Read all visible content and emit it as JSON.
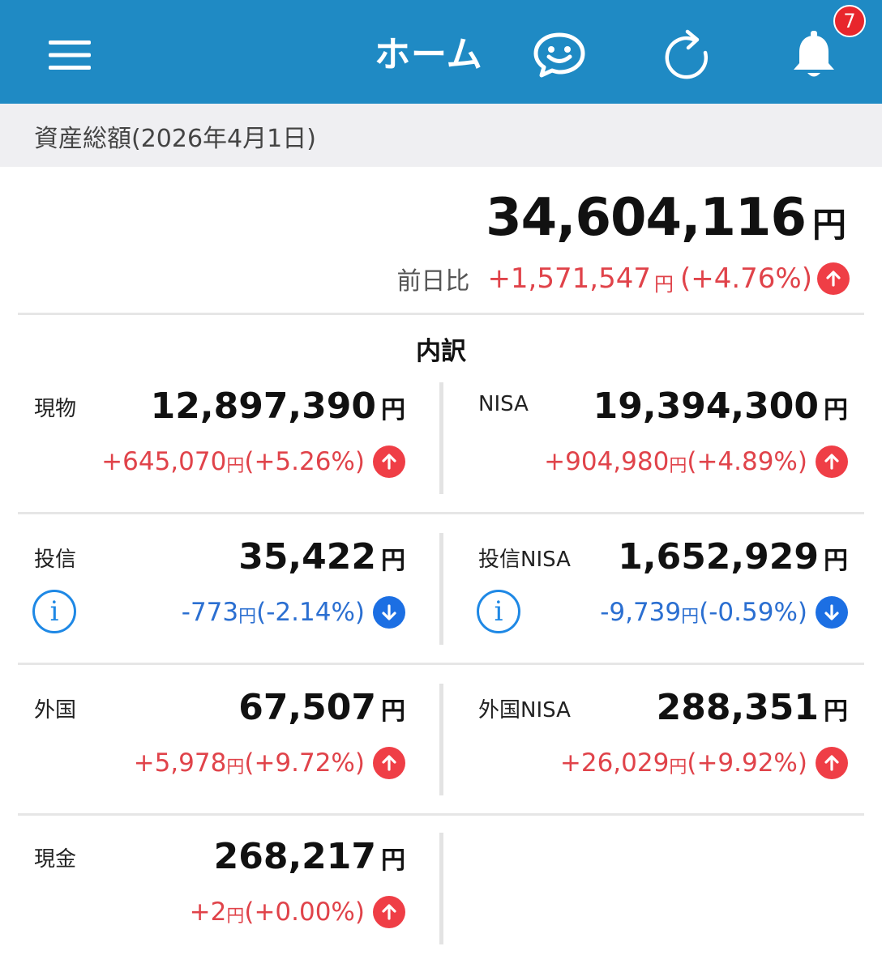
{
  "header": {
    "title": "ホーム",
    "badge_count": "7",
    "color": "#1f8ac4"
  },
  "summary": {
    "date_label": "資産総額(2026年4月1日)",
    "total_value": "34,604,116",
    "currency": "円",
    "change_label": "前日比",
    "change_value": "+1,571,547",
    "change_pct": "(+4.76%)"
  },
  "breakdown": {
    "title": "内訳",
    "items": [
      {
        "label": "現物",
        "value": "12,897,390",
        "yen": "円",
        "change": "+645,070",
        "pct": "(+5.26%)",
        "direction": "up"
      },
      {
        "label": "NISA",
        "value": "19,394,300",
        "yen": "円",
        "change": "+904,980",
        "pct": "(+4.89%)",
        "direction": "up"
      },
      {
        "label": "投信",
        "value": "35,422",
        "yen": "円",
        "change": "-773",
        "pct": "(-2.14%)",
        "direction": "down"
      },
      {
        "label": "投信NISA",
        "value": "1,652,929",
        "yen": "円",
        "change": "-9,739",
        "pct": "(-0.59%)",
        "direction": "down"
      },
      {
        "label": "外国",
        "value": "67,507",
        "yen": "円",
        "change": "+5,978",
        "pct": "(+9.72%)",
        "direction": "up"
      },
      {
        "label": "外国NISA",
        "value": "288,351",
        "yen": "円",
        "change": "+26,029",
        "pct": "(+9.92%)",
        "direction": "up"
      },
      {
        "label": "現金",
        "value": "268,217",
        "yen": "円",
        "change": "+2",
        "pct": "(+0.00%)",
        "direction": "up"
      }
    ]
  },
  "colors": {
    "up": "#e0434a",
    "down": "#2b6fd1",
    "info": "#1e88e5"
  }
}
